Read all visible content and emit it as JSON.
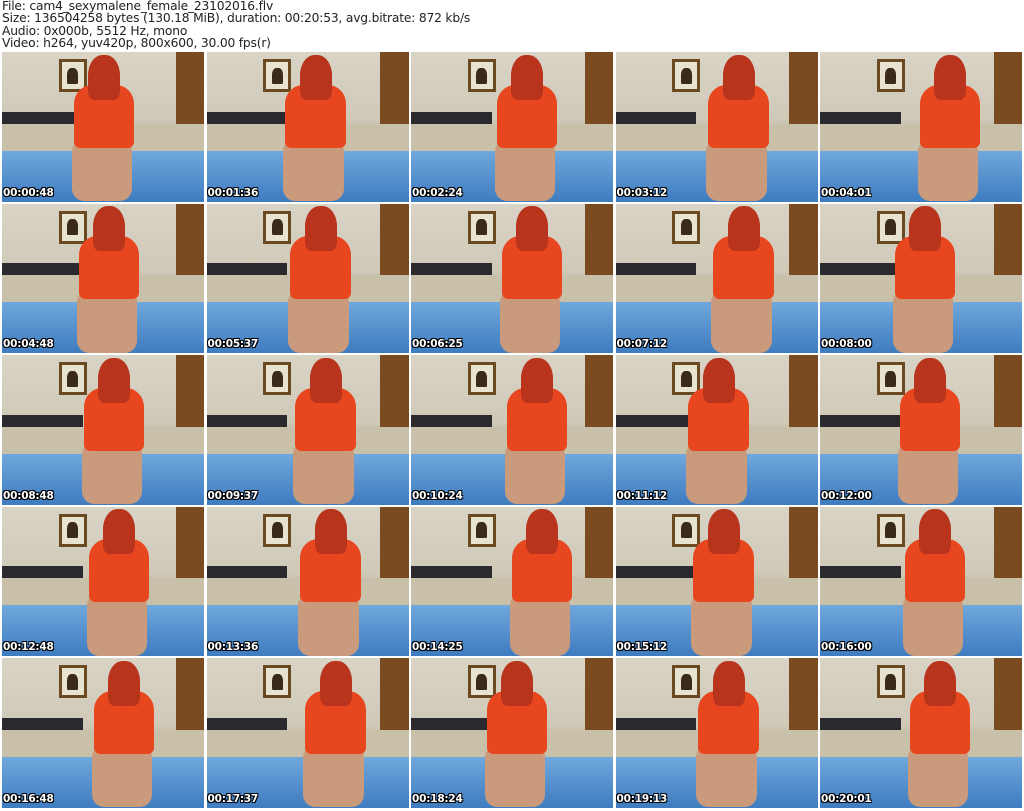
{
  "header": {
    "file": "File: cam4_sexymalene_female_23102016.flv",
    "size": "Size: 136504258 bytes (130.18 MiB), duration: 00:20:53, avg.bitrate: 872 kb/s",
    "audio": "Audio: 0x000b, 5512 Hz, mono",
    "video": "Video: h264, yuv420p, 800x600, 30.00 fps(r)"
  },
  "thumbnails": [
    {
      "timestamp": "00:00:48"
    },
    {
      "timestamp": "00:01:36"
    },
    {
      "timestamp": "00:02:24"
    },
    {
      "timestamp": "00:03:12"
    },
    {
      "timestamp": "00:04:01"
    },
    {
      "timestamp": "00:04:48"
    },
    {
      "timestamp": "00:05:37"
    },
    {
      "timestamp": "00:06:25"
    },
    {
      "timestamp": "00:07:12"
    },
    {
      "timestamp": "00:08:00"
    },
    {
      "timestamp": "00:08:48"
    },
    {
      "timestamp": "00:09:37"
    },
    {
      "timestamp": "00:10:24"
    },
    {
      "timestamp": "00:11:12"
    },
    {
      "timestamp": "00:12:00"
    },
    {
      "timestamp": "00:12:48"
    },
    {
      "timestamp": "00:13:36"
    },
    {
      "timestamp": "00:14:25"
    },
    {
      "timestamp": "00:15:12"
    },
    {
      "timestamp": "00:16:00"
    },
    {
      "timestamp": "00:16:48"
    },
    {
      "timestamp": "00:17:37"
    },
    {
      "timestamp": "00:18:24"
    },
    {
      "timestamp": "00:19:13"
    },
    {
      "timestamp": "00:20:01"
    }
  ]
}
